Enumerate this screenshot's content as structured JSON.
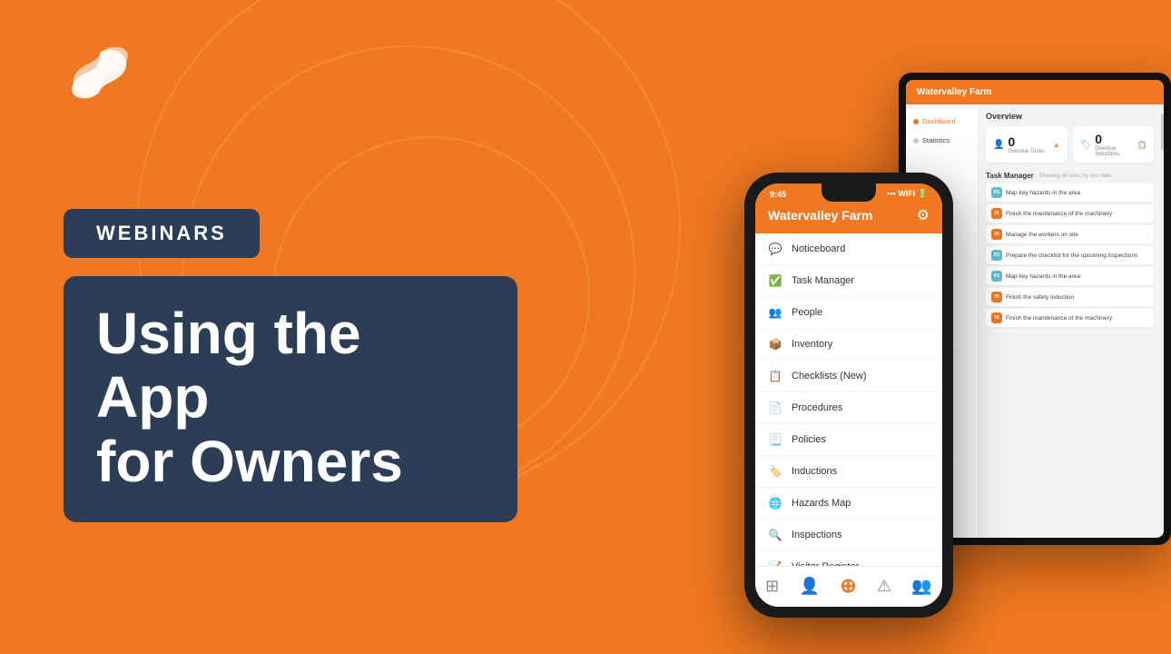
{
  "background": {
    "color": "#F07820"
  },
  "logo": {
    "alt": "S logo"
  },
  "left_content": {
    "badge": "WEBINARS",
    "title_line1": "Using the App",
    "title_line2": "for Owners"
  },
  "phone": {
    "status_time": "9:45",
    "header_title": "Watervalley Farm",
    "menu_items": [
      {
        "icon": "💬",
        "label": "Noticeboard"
      },
      {
        "icon": "✅",
        "label": "Task Manager"
      },
      {
        "icon": "👥",
        "label": "People"
      },
      {
        "icon": "📦",
        "label": "Inventory"
      },
      {
        "icon": "📋",
        "label": "Checklists (New)"
      },
      {
        "icon": "📄",
        "label": "Procedures"
      },
      {
        "icon": "📃",
        "label": "Policies"
      },
      {
        "icon": "🏷️",
        "label": "Inductions"
      },
      {
        "icon": "🌐",
        "label": "Hazards Map"
      },
      {
        "icon": "🔍",
        "label": "Inspections"
      },
      {
        "icon": "📝",
        "label": "Visitor Register"
      }
    ],
    "bottom_nav": [
      "⊞",
      "👤",
      "➕",
      "⚠",
      "👤+"
    ]
  },
  "tablet": {
    "header_title": "Watervalley Farm",
    "sidebar_items": [
      {
        "label": "Dashboard",
        "active": true
      },
      {
        "label": "Statistics",
        "active": false
      }
    ],
    "overview_title": "Overview",
    "cards": [
      {
        "num": "0",
        "label": "Overdue Tasks",
        "color": "green"
      },
      {
        "num": "0",
        "label": "Overdue Inductions",
        "color": "red"
      }
    ],
    "task_section_title": "Task Manager",
    "task_subtitle": "Showing all tasks by due date",
    "tasks": [
      {
        "badge": "P2",
        "label": "Map key hazards in the area",
        "color": "blue"
      },
      {
        "badge": "HI",
        "label": "Finish the maintenance of the machinery",
        "color": "orange"
      },
      {
        "badge": "HI",
        "label": "Manage the workers on site",
        "color": "orange"
      },
      {
        "badge": "P2",
        "label": "Prepare the checklist for the upcoming inspections",
        "color": "blue"
      },
      {
        "badge": "P2",
        "label": "Map key hazards in the area",
        "color": "blue"
      },
      {
        "badge": "HI",
        "label": "Finish the safety induction",
        "color": "orange"
      },
      {
        "badge": "HI",
        "label": "Finish the maintenance of the machinery",
        "color": "orange"
      }
    ]
  }
}
